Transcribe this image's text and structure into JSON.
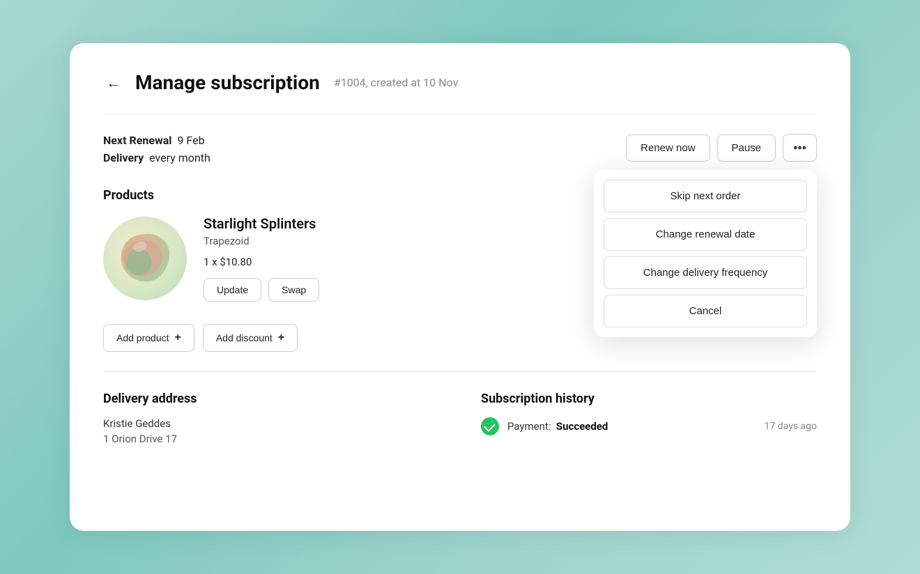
{
  "page": {
    "title": "Manage subscription",
    "subscription_id": "#1004, created at 10 Nov",
    "back_label": "←"
  },
  "renewal": {
    "next_renewal_label": "Next Renewal",
    "next_renewal_date": "9 Feb",
    "delivery_label": "Delivery",
    "delivery_frequency": "every month"
  },
  "action_buttons": {
    "renew_now": "Renew now",
    "pause": "Pause",
    "dots": "•••"
  },
  "dropdown": {
    "skip_next_order": "Skip next order",
    "change_renewal_date": "Change renewal date",
    "change_delivery_frequency": "Change delivery frequency",
    "cancel": "Cancel"
  },
  "products": {
    "section_title": "Products",
    "product": {
      "name": "Starlight Splinters",
      "brand": "Trapezoid",
      "quantity": "1 x $10.80",
      "update_btn": "Update",
      "swap_btn": "Swap"
    },
    "add_product_btn": "Add product",
    "add_discount_btn": "Add discount"
  },
  "delivery_address": {
    "section_title": "Delivery address",
    "name": "Kristie Geddes",
    "address_line1": "1 Orion Drive 17"
  },
  "subscription_history": {
    "section_title": "Subscription history",
    "items": [
      {
        "label": "Payment:",
        "status": "Succeeded",
        "time": "17 days ago"
      }
    ]
  }
}
